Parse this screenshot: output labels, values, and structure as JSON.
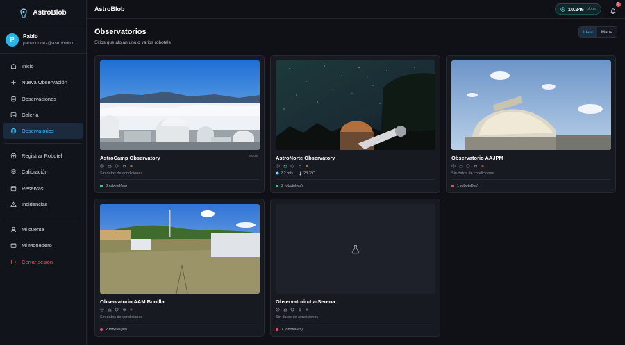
{
  "app": {
    "name": "AstroBlob"
  },
  "user": {
    "initial": "P",
    "name": "Pablo",
    "email": "pablo.nunez@astroblob.c..."
  },
  "nav": {
    "inicio": "Inicio",
    "nueva": "Nueva Observación",
    "observaciones": "Observaciones",
    "galeria": "Galería",
    "observatorios": "Observatorios",
    "registrar": "Registrar Robotel",
    "calibracion": "Calibración",
    "reservas": "Reservas",
    "incidencias": "Incidencias",
    "cuenta": "Mi cuenta",
    "monedero": "Mi Monedero",
    "logout": "Cerrar sesión"
  },
  "topbar": {
    "title": "AstroBlob",
    "balance": "10.246",
    "balance_unit": "blobs",
    "notifications": "5"
  },
  "page": {
    "title": "Observatorios",
    "subtitle": "Sitios que alojan uno o varios robotels",
    "view_list": "Lista",
    "view_map": "Mapa"
  },
  "colors": {
    "accent": "#49b6ee",
    "online": "#2fd37a",
    "offline": "#ef4f5c"
  },
  "observatories": [
    {
      "name": "AstroCamp Observatory",
      "code": "02036",
      "conditions": "Sin datos de condiciones",
      "robots": "8 robotel(es)",
      "status": "online"
    },
    {
      "name": "AstroNorte Observatory",
      "wind": "2.2 m/s",
      "temp": "28.3°C",
      "robots": "2 robotel(es)",
      "status": "online"
    },
    {
      "name": "Observatorio AAJPM",
      "conditions": "Sin datos de condiciones",
      "robots": "1 robotel(es)",
      "status": "offline"
    },
    {
      "name": "Observatorio AAM Bonilla",
      "conditions": "Sin datos de condiciones",
      "robots": "2 robotel(es)",
      "status": "offline"
    },
    {
      "name": "Observatorio-La-Serena",
      "conditions": "Sin datos de condiciones",
      "robots": "1 robotel(es)",
      "status": "offline"
    }
  ]
}
